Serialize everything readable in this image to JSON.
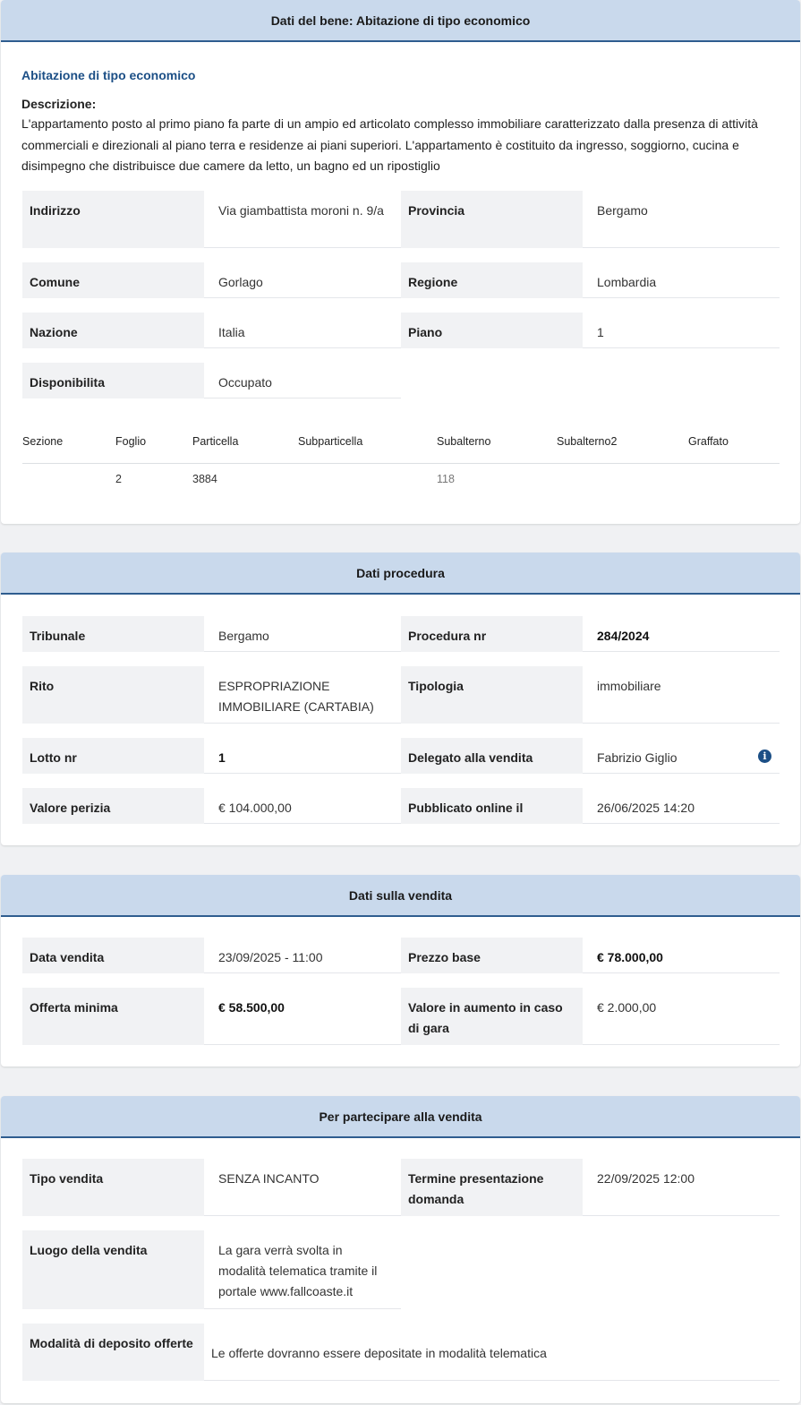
{
  "bene": {
    "header": "Dati del bene: Abitazione di tipo economico",
    "subtitle": "Abitazione di tipo economico",
    "desc_label": "Descrizione:",
    "desc_text": "L'appartamento posto al primo piano fa parte di un ampio ed articolato complesso immobiliare caratterizzato dalla presenza di attività commerciali e direzionali al piano terra e residenze ai piani superiori. L'appartamento è costituito da ingresso, soggiorno, cucina e disimpegno che distribuisce due camere da letto, un bagno ed un ripostiglio",
    "fields": {
      "indirizzo_label": "Indirizzo",
      "indirizzo": "Via giambattista moroni n. 9/a",
      "provincia_label": "Provincia",
      "provincia": "Bergamo",
      "comune_label": "Comune",
      "comune": "Gorlago",
      "regione_label": "Regione",
      "regione": "Lombardia",
      "nazione_label": "Nazione",
      "nazione": "Italia",
      "piano_label": "Piano",
      "piano": "1",
      "disponibilita_label": "Disponibilita",
      "disponibilita": "Occupato"
    },
    "catasto": {
      "headers": [
        "Sezione",
        "Foglio",
        "Particella",
        "Subparticella",
        "Subalterno",
        "Subalterno2",
        "Graffato"
      ],
      "row": [
        "",
        "2",
        "3884",
        "",
        "118",
        "",
        ""
      ]
    }
  },
  "procedura": {
    "header": "Dati procedura",
    "tribunale_label": "Tribunale",
    "tribunale": "Bergamo",
    "procedura_label": "Procedura nr",
    "procedura": "284/2024",
    "rito_label": "Rito",
    "rito": "ESPROPRIAZIONE IMMOBILIARE (CARTABIA)",
    "tipologia_label": "Tipologia",
    "tipologia": "immobiliare",
    "lotto_label": "Lotto nr",
    "lotto": "1",
    "delegato_label": "Delegato alla vendita",
    "delegato": "Fabrizio Giglio",
    "perizia_label": "Valore perizia",
    "perizia": "€ 104.000,00",
    "pubblicato_label": "Pubblicato online il",
    "pubblicato": "26/06/2025 14:20"
  },
  "vendita": {
    "header": "Dati sulla vendita",
    "data_label": "Data vendita",
    "data": "23/09/2025 - 11:00",
    "prezzo_label": "Prezzo base",
    "prezzo": "€ 78.000,00",
    "offerta_label": "Offerta minima",
    "offerta": "€ 58.500,00",
    "aumento_label": "Valore in aumento in caso di gara",
    "aumento": "€ 2.000,00"
  },
  "partecipare": {
    "header": "Per partecipare alla vendita",
    "tipo_label": "Tipo vendita",
    "tipo": "SENZA INCANTO",
    "termine_label": "Termine presentazione domanda",
    "termine": "22/09/2025 12:00",
    "luogo_label": "Luogo della vendita",
    "luogo": "La gara verrà svolta in modalità telematica tramite il portale www.fallcoaste.it",
    "deposito_label": "Modalità di deposito offerte",
    "deposito": "Le offerte dovranno essere depositate in modalità telematica"
  },
  "colors": {
    "header_bg": "#c9d9ec",
    "header_border": "#2f5d8f",
    "accent": "#1c4f86",
    "label_bg": "#f1f2f4"
  },
  "icons": {
    "delegato_info": "info-icon"
  }
}
